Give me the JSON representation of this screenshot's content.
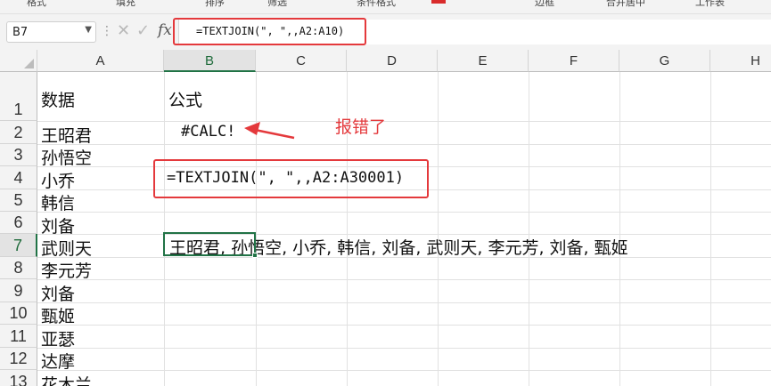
{
  "toolbar": {
    "items": [
      "格式",
      "填充",
      "排序",
      "筛选",
      "条件格式",
      "边框",
      "合并居中",
      "工作表"
    ]
  },
  "formula_bar": {
    "name_box": "B7",
    "formula": "=TEXTJOIN(\", \",,A2:A10)"
  },
  "columns": [
    "A",
    "B",
    "C",
    "D",
    "E",
    "F",
    "G",
    "H"
  ],
  "rows": [
    "1",
    "2",
    "3",
    "4",
    "5",
    "6",
    "7",
    "8",
    "9",
    "10",
    "11",
    "12",
    "13"
  ],
  "cells": {
    "A1": "数据",
    "B1": "公式",
    "A2": "王昭君",
    "A3": "孙悟空",
    "A4": "小乔",
    "A5": "韩信",
    "A6": "刘备",
    "A7": "武则天",
    "A8": "李元芳",
    "A9": "刘备",
    "A10": "甄姬",
    "A11": "亚瑟",
    "A12": "达摩",
    "A13": "花木兰",
    "B2": "#CALC!",
    "B4": "=TEXTJOIN(\", \",,A2:A30001)",
    "B7": "王昭君, 孙悟空, 小乔, 韩信, 刘备, 武则天, 李元芳, 刘备, 甄姬"
  },
  "annotation": {
    "error_label": "报错了",
    "accent_color": "#e4393c"
  },
  "selection": {
    "cell": "B7",
    "accent_color": "#217346"
  }
}
